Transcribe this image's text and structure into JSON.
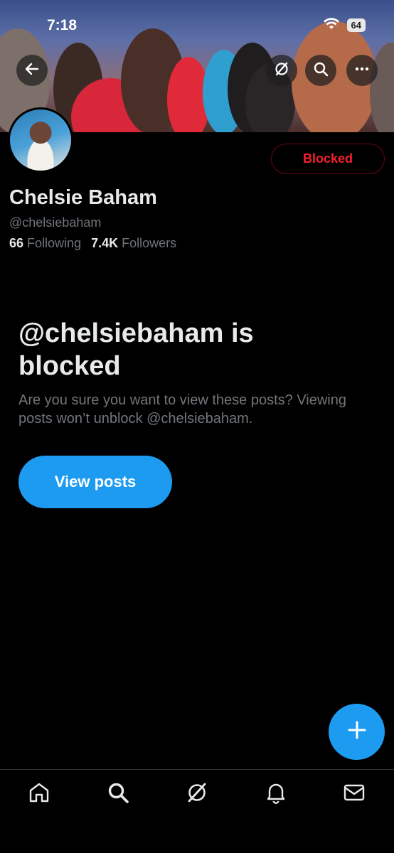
{
  "status_bar": {
    "time": "7:18",
    "battery": "64"
  },
  "header": {
    "back_icon": "arrow-left-icon",
    "grok_icon": "grok-icon",
    "search_icon": "search-icon",
    "more_icon": "more-icon"
  },
  "profile": {
    "name": "Chelsie Baham",
    "handle": "@chelsiebaham",
    "following_count": "66",
    "following_label": "Following",
    "followers_count": "7.4K",
    "followers_label": "Followers",
    "blocked_button_label": "Blocked"
  },
  "blocked_notice": {
    "title": "@chelsiebaham is blocked",
    "description": "Are you sure you want to view these posts? Viewing posts won’t unblock @chelsiebaham.",
    "view_posts_label": "View posts"
  },
  "fab": {
    "icon": "plus-icon"
  },
  "bottom_nav": {
    "items": [
      {
        "icon": "home-icon"
      },
      {
        "icon": "search-icon"
      },
      {
        "icon": "grok-icon"
      },
      {
        "icon": "bell-icon"
      },
      {
        "icon": "mail-icon"
      }
    ]
  },
  "colors": {
    "background": "#000000",
    "accent": "#1d9bf0",
    "blocked_red": "#f4212e",
    "secondary_text": "#71767b",
    "primary_text": "#e7e9ea"
  }
}
